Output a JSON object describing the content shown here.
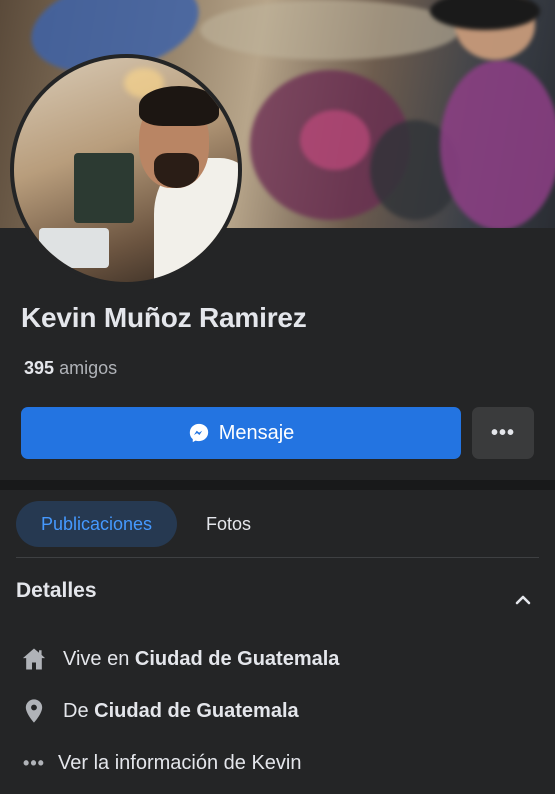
{
  "profile": {
    "name": "Kevin Muñoz Ramirez",
    "friends_count": "395",
    "friends_label": "amigos"
  },
  "actions": {
    "message_label": "Mensaje",
    "more_label": "•••"
  },
  "tabs": [
    {
      "label": "Publicaciones",
      "active": true
    },
    {
      "label": "Fotos",
      "active": false
    }
  ],
  "details": {
    "title": "Detalles",
    "items": [
      {
        "icon": "home-icon",
        "prefix": "Vive en",
        "value": "Ciudad de Guatemala"
      },
      {
        "icon": "location-pin-icon",
        "prefix": "De",
        "value": "Ciudad de Guatemala"
      },
      {
        "icon": "more-dots-icon",
        "prefix": "Ver la información de Kevin",
        "value": ""
      }
    ]
  },
  "colors": {
    "background": "#242526",
    "accent": "#2374e1",
    "active_tab_bg": "#263951",
    "active_tab_text": "#4599ff"
  }
}
